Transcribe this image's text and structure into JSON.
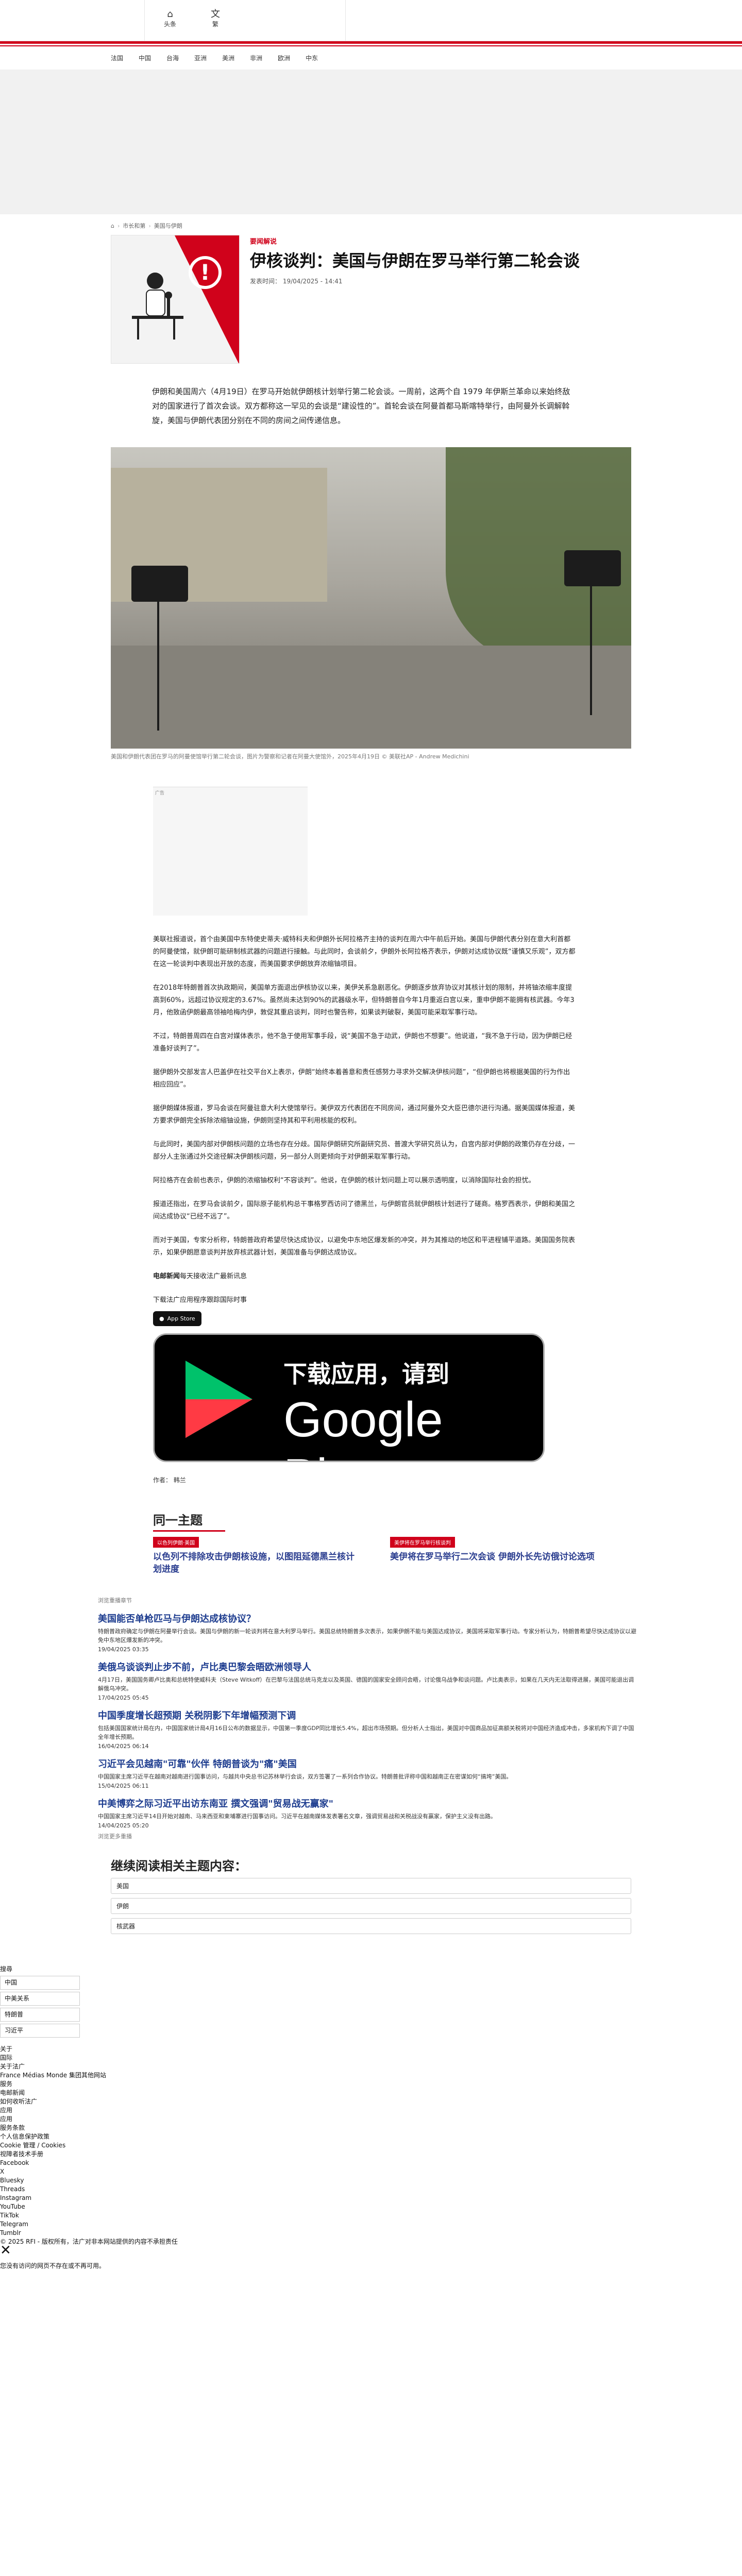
{
  "topnav": {
    "home": "头条",
    "lang": "繁"
  },
  "categories": [
    "法国",
    "中国",
    "台海",
    "亚洲",
    "美洲",
    "非洲",
    "欧洲",
    "中东"
  ],
  "breadcrumb": {
    "item1": "市长和第",
    "item2": "美国与伊朗"
  },
  "article": {
    "kicker": "要闻解说",
    "title": "伊核谈判：美国与伊朗在罗马举行第二轮会谈",
    "date": "发表时间：  19/04/2025 - 14:41",
    "lead": "伊朗和美国周六（4月19日）在罗马开始就伊朗核计划举行第二轮会谈。一周前，这两个自 1979 年伊斯兰革命以来始终敌对的国家进行了首次会谈。双方都称这一罕见的会谈是“建设性的”。首轮会谈在阿曼首都马斯喀特举行，由阿曼外长调解斡旋，美国与伊朗代表团分别在不同的房间之间传递信息。",
    "caption": "美国和伊朗代表团在罗马的阿曼使馆举行第二轮会谈，图片为警察和记者在阿曼大使馆外，2025年4月19日 © 美联社AP - Andrew Medichini",
    "ad_label": "广告",
    "paragraphs": [
      "美联社报道说，首个由美国中东特使史蒂夫·威特科夫和伊朗外长阿拉格齐主持的谈判在周六中午前后开始。美国与伊朗代表分别在意大利首都的阿曼使馆，就伊朗可能研制核武器的问题进行接触。与此同时，会谈前夕，伊朗外长阿拉格齐表示，伊朗对达成协议既“谨慎又乐观”，双方都在这一轮谈判中表现出开放的态度，而美国要求伊朗放弃浓缩铀项目。",
      "在2018年特朗普首次执政期间，美国单方面退出伊核协议以来，美伊关系急剧恶化。伊朗逐步放弃协议对其核计划的限制，并将铀浓缩丰度提高到60%，远超过协议规定的3.67%。虽然尚未达到90%的武器级水平，但特朗普自今年1月重返白宫以来，重申伊朗不能拥有核武器。今年3月，他致函伊朗最高领袖哈梅内伊，敦促其重启谈判，同时也警告称，如果谈判破裂，美国可能采取军事行动。",
      "不过，特朗普周四在白宫对媒体表示，他不急于使用军事手段，说“美国不急于动武，伊朗也不想要”。他说道，“我不急于行动，因为伊朗已经准备好谈判了”。",
      "据伊朗外交部发言人巴盖伊在社交平台X上表示，伊朗“始终本着善意和责任感努力寻求外交解决伊核问题”，“但伊朗也将根据美国的行为作出相应回应”。",
      "据伊朗媒体报道，罗马会谈在阿曼驻意大利大使馆举行。美伊双方代表团在不同房间，通过阿曼外交大臣巴德尔进行沟通。据美国媒体报道，美方要求伊朗完全拆除浓缩铀设施，伊朗则坚持其和平利用核能的权利。",
      "与此同时，美国内部对伊朗核问题的立场也存在分歧。国际伊朗研究所副研究员、普渡大学研究员认为，白宫内部对伊朗的政策仍存在分歧，一部分人主张通过外交途径解决伊朗核问题，另一部分人则更倾向于对伊朗采取军事行动。",
      "阿拉格齐在会前也表示，伊朗的浓缩铀权利“不容谈判”。他说，在伊朗的核计划问题上可以展示透明度，以消除国际社会的担忧。",
      "报道还指出，在罗马会谈前夕，国际原子能机构总干事格罗西访问了德黑兰，与伊朗官员就伊朗核计划进行了磋商。格罗西表示，伊朗和美国之间达成协议“已经不远了”。",
      "而对于美国，专家分析称，特朗普政府希望尽快达成协议，以避免中东地区爆发新的冲突，并为其推动的地区和平进程铺平道路。美国国务院表示，如果伊朗愿意谈判并放弃核武器计划，美国准备与伊朗达成协议。"
    ],
    "source_line": "电邮新闻",
    "source_rest": "每天接收法广最新讯息",
    "app_intro": "下载法广应用程序跟踪国际时事",
    "appstore_label": "App Store",
    "gplay_line1": "下载应用，请到",
    "gplay_line2": "Google Play",
    "author": "作者：  韩兰"
  },
  "topic": {
    "heading": "同一主题",
    "cards": [
      {
        "tag": "以色列伊朗·美国",
        "title": "以色列不排除攻击伊朗核设施，以图阻延德黑兰核计划进度"
      },
      {
        "tag": "美伊将在罗马举行核谈判",
        "title": "美伊将在罗马举行二次会谈 伊朗外长先访俄讨论选项"
      }
    ]
  },
  "related": {
    "label": "浏览重播章节",
    "items": [
      {
        "title": "美国能否单枪匹马与伊朗达成核协议？",
        "desc": "特朗普政府确定与伊朗在阿曼举行会谈。美国与伊朗的新一轮谈判将在意大利罗马举行。美国总统特朗普多次表示，如果伊朗不能与美国达成协议，美国将采取军事行动。专家分析认为，特朗普希望尽快达成协议以避免中东地区爆发新的冲突。",
        "date": "19/04/2025 03:35"
      },
      {
        "title": "美俄乌谈谈判止步不前，卢比奥巴黎会晤欧洲领导人",
        "desc": "4月17日，美国国务卿卢比奥和总统特使威科夫（Steve Witkoff）在巴黎与法国总统马克龙以及英国、德国的国家安全顾问会晤，讨论俄乌战争和谈问题。卢比奥表示，如果在几天内无法取得进展，美国可能退出调解俄乌冲突。",
        "date": "17/04/2025 05:45"
      },
      {
        "title": "中国季度增长超预期 关税阴影下年增幅预测下调",
        "desc": "包括美国国家统计局在内，中国国家统计局4月16日公布的数据显示，中国第一季度GDP同比增长5.4%，超出市场预期。但分析人士指出，美国对中国商品加征高额关税将对中国经济造成冲击，多家机构下调了中国全年增长预期。",
        "date": "16/04/2025 06:14"
      },
      {
        "title": "习近平会见越南\"可靠\"伙伴 特朗普谈为\"痛\"美国",
        "desc": "中国国家主席习近平在越南对越南进行国事访问，与越共中央总书记苏林举行会谈，双方签署了一系列合作协议。特朗普批评称中国和越南正在密谋如何“搞垮”美国。",
        "date": "15/04/2025 06:11"
      },
      {
        "title": "中美博弈之际习近平出访东南亚 撰文强调\"贸易战无赢家\"",
        "desc": "中国国家主席习近平14日开始对越南、马来西亚和柬埔寨进行国事访问。习近平在越南媒体发表署名文章，强调贸易战和关税战没有赢家，保护主义没有出路。",
        "date": "14/04/2025 05:20"
      }
    ],
    "more_label": "浏览更多重播"
  },
  "more_topics": {
    "heading": "继续阅读相关主题内容：",
    "items": [
      "美国",
      "伊朗",
      "核武器"
    ]
  },
  "footer": {
    "fields": [
      "中国",
      "中美关系",
      "特朗普",
      "习近平"
    ],
    "label_search": "搜尋",
    "section_label": "关于",
    "lines": [
      "国际",
      "关于法广",
      "France Médias Monde 集团其他网站",
      "服务",
      "电邮新闻",
      "如何收听法广",
      "应用",
      "应用",
      "服务条款",
      "个人信息保护政策",
      "Cookie 管理 / Cookies",
      "视障者技术手册",
      "Facebook",
      "X",
      "Bluesky",
      "Threads",
      "Instagram",
      "YouTube",
      "TikTok",
      "Telegram",
      "Tumblr",
      "© 2025 RFI - 版权所有，法广对非本网站提供的内容不承担责任"
    ],
    "close_label": "✕",
    "bottom_text": "您没有访问的网页不存在或不再可用。"
  },
  "colors": {
    "accent": "#d0021b",
    "link": "#1d3c8f"
  }
}
